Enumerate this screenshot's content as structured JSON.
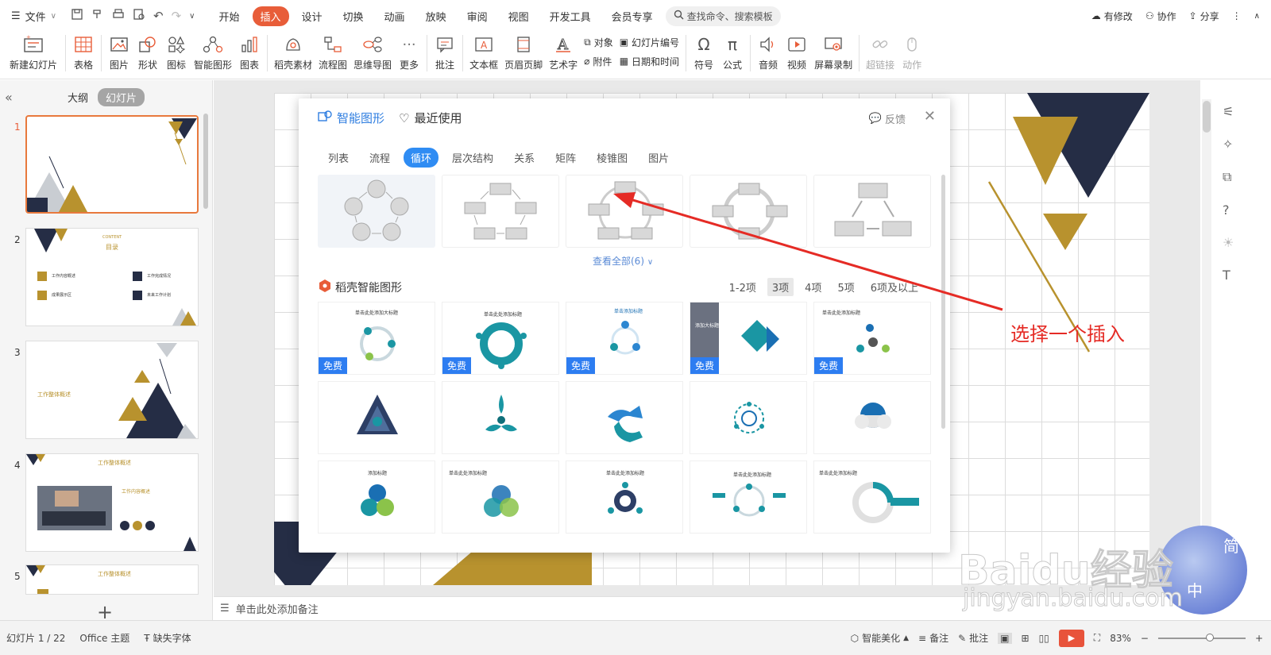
{
  "menubar": {
    "file_label": "文件",
    "tabs": [
      {
        "label": "开始"
      },
      {
        "label": "插入"
      },
      {
        "label": "设计"
      },
      {
        "label": "切换"
      },
      {
        "label": "动画"
      },
      {
        "label": "放映"
      },
      {
        "label": "审阅"
      },
      {
        "label": "视图"
      },
      {
        "label": "开发工具"
      },
      {
        "label": "会员专享"
      }
    ],
    "active_tab": "插入",
    "search_placeholder": "查找命令、搜索模板",
    "right": {
      "changes": "有修改",
      "collab": "协作",
      "share": "分享"
    }
  },
  "ribbon": {
    "new_slide": "新建幻灯片",
    "table": "表格",
    "picture": "图片",
    "shape": "形状",
    "icon": "图标",
    "smart_graphic": "智能图形",
    "chart": "图表",
    "docer_material": "稻壳素材",
    "flowchart": "流程图",
    "mindmap": "思维导图",
    "more": "更多",
    "comment": "批注",
    "textbox": "文本框",
    "header_footer": "页眉页脚",
    "wordart": "艺术字",
    "object": "对象",
    "attachment": "附件",
    "slide_number": "幻灯片编号",
    "datetime": "日期和时间",
    "symbol": "符号",
    "formula": "公式",
    "audio": "音频",
    "video": "视频",
    "screen_record": "屏幕录制",
    "hyperlink": "超链接",
    "action": "动作"
  },
  "left_panel": {
    "outline_tab": "大纲",
    "slides_tab": "幻灯片",
    "thumbnails": [
      {
        "number": "1"
      },
      {
        "number": "2",
        "texts": [
          "CONTENT",
          "目录",
          "工作内容概述",
          "工作完成情况",
          "成果展示区",
          "未来工作计划"
        ]
      },
      {
        "number": "3",
        "texts": [
          "工作整体概述"
        ]
      },
      {
        "number": "4",
        "texts": [
          "工作整体概述",
          "工作内容概述"
        ]
      },
      {
        "number": "5",
        "texts": [
          "工作整体概述"
        ]
      }
    ]
  },
  "notes_placeholder": "单击此处添加备注",
  "statusbar": {
    "slide_info": "幻灯片 1 / 22",
    "theme": "Office 主题",
    "missing_font": "缺失字体",
    "beautify": "智能美化",
    "notes": "备注",
    "comments": "批注",
    "zoom": "83%"
  },
  "dialog": {
    "title": "智能图形",
    "recent": "最近使用",
    "feedback": "反馈",
    "tabs": [
      {
        "label": "列表"
      },
      {
        "label": "流程"
      },
      {
        "label": "循环"
      },
      {
        "label": "层次结构"
      },
      {
        "label": "关系"
      },
      {
        "label": "矩阵"
      },
      {
        "label": "棱锥图"
      },
      {
        "label": "图片"
      }
    ],
    "active_tab": "循环",
    "view_all": "查看全部(6)",
    "section_title": "稻壳智能图形",
    "filters": [
      {
        "label": "1-2项"
      },
      {
        "label": "3项"
      },
      {
        "label": "4项"
      },
      {
        "label": "5项"
      },
      {
        "label": "6项及以上"
      }
    ],
    "active_filter": "3项",
    "free_badge": "免费",
    "templates": [
      {
        "title": "单击此处添加大标题",
        "free": true
      },
      {
        "title": "单击此处添加标题",
        "free": true
      },
      {
        "title": "单击添加标题",
        "free": true
      },
      {
        "title": "添加大标题",
        "free": true
      },
      {
        "title": "单击此处添加标题",
        "free": true
      },
      {
        "title": "",
        "free": false
      },
      {
        "title": "",
        "free": false
      },
      {
        "title": "",
        "free": false
      },
      {
        "title": "",
        "free": false
      },
      {
        "title": "",
        "free": false
      },
      {
        "title": "添加标题",
        "free": false
      },
      {
        "title": "单击此处添加标题",
        "free": false
      },
      {
        "title": "单击此处添加标题",
        "free": false
      },
      {
        "title": "单击此处添加标题",
        "free": false
      },
      {
        "title": "单击此处添加标题",
        "free": false
      }
    ]
  },
  "annotation": {
    "text": "选择一个插入",
    "color": "#e52b25"
  },
  "watermark": {
    "brand": "Baidu经验",
    "url": "jingyan.baidu.com",
    "badge_top": "简",
    "badge_bottom": "中"
  },
  "colors": {
    "accent": "#e85d39",
    "dialog_blue": "#2f8cf3",
    "navy": "#252d45",
    "gold": "#b8922e"
  }
}
